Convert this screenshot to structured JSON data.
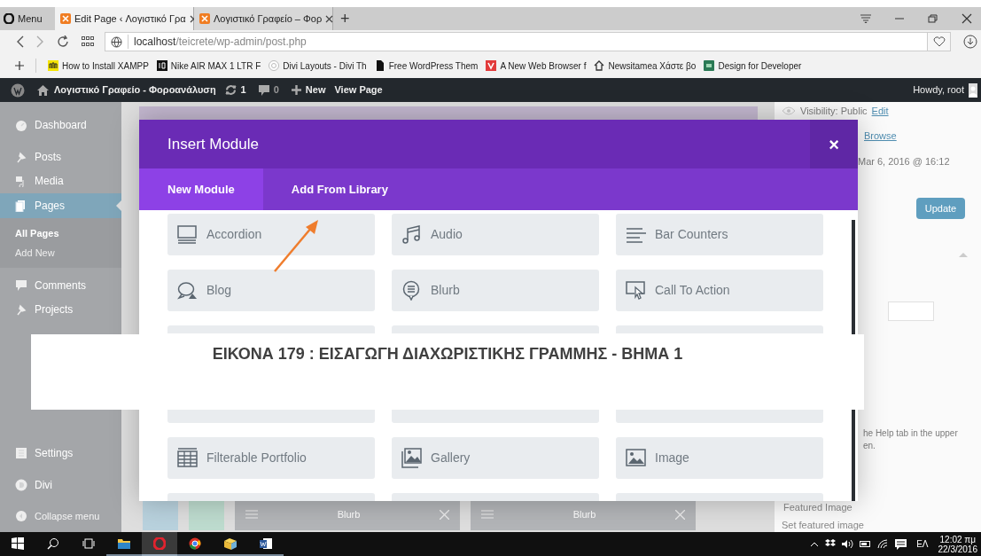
{
  "browser": {
    "menu": "Menu",
    "tabs": [
      {
        "label": "Edit Page ‹ Λογιστικό Γρα",
        "selected": true
      },
      {
        "label": "Λογιστικό Γραφείο – Φορ",
        "selected": false
      }
    ],
    "new_tab": "+",
    "url_host": "localhost",
    "url_path": "/teicrete/wp-admin/post.php",
    "bookmarks": [
      {
        "label": "How to Install XAMPP"
      },
      {
        "label": "Nike AIR MAX 1 LTR F"
      },
      {
        "label": "Divi Layouts - Divi Th"
      },
      {
        "label": "Free WordPress Them"
      },
      {
        "label": "A New Web Browser f"
      },
      {
        "label": "Newsitamea Χάστε βο"
      },
      {
        "label": "Design for Developer"
      }
    ]
  },
  "admin_bar": {
    "site": "Λογιστικό Γραφείο - Φοροανάλυση",
    "updates": "1",
    "comments": "0",
    "new": "New",
    "view": "View Page",
    "howdy": "Howdy, root"
  },
  "sidebar": {
    "items": [
      {
        "label": "Dashboard",
        "selected": false
      },
      {
        "label": "Posts",
        "selected": false
      },
      {
        "label": "Media",
        "selected": false
      },
      {
        "label": "Pages",
        "selected": true,
        "children": [
          {
            "label": "All Pages",
            "selected": true
          },
          {
            "label": "Add New",
            "selected": false
          }
        ]
      },
      {
        "label": "Comments",
        "selected": false
      },
      {
        "label": "Projects",
        "selected": false
      }
    ],
    "lower_items": [
      {
        "label": "Settings"
      },
      {
        "label": "Divi"
      },
      {
        "label": "Collapse menu"
      }
    ]
  },
  "right_panel": {
    "visibility": "Visibility: Public",
    "visibility_link": "Edit",
    "browse": "Browse",
    "date": "Mar 6, 2016 @ 16:12",
    "update": "Update",
    "help": "he Help tab in the upper",
    "help_2": "en.",
    "featured": "Featured Image",
    "set_featured": "Set featured image"
  },
  "builder_row": [
    "Blurb",
    "Blurb"
  ],
  "modal": {
    "title": "Insert Module",
    "close": "×",
    "tabs": [
      {
        "label": "New Module",
        "selected": true
      },
      {
        "label": "Add From Library",
        "selected": false
      }
    ],
    "modules": [
      {
        "label": "Accordion"
      },
      {
        "label": "Audio"
      },
      {
        "label": "Bar Counters"
      },
      {
        "label": "Blog"
      },
      {
        "label": "Blurb"
      },
      {
        "label": "Call To Action"
      },
      {
        "label": "Filterable Portfolio"
      },
      {
        "label": "Gallery"
      },
      {
        "label": "Image"
      }
    ]
  },
  "caption": "ΕΙΚΟΝΑ 179 : ΕΙΣΑΓΩΓΗ ΔΙΑΧΩΡΙΣΤΙΚΗΣ ΓΡΑΜΜΗΣ - ΒΗΜΑ 1",
  "taskbar": {
    "language": "ΕΛ",
    "time": "12:02 πμ",
    "date": "22/3/2016"
  }
}
